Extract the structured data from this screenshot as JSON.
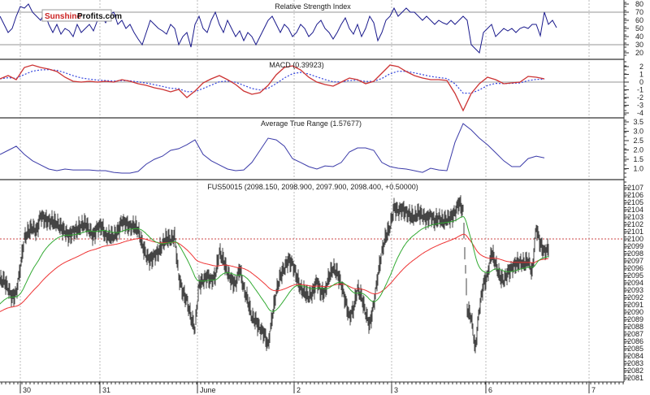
{
  "logo": {
    "part1": "Sunshine",
    "part2": "Profits.com",
    "color1": "#cc2222",
    "color2": "#111111"
  },
  "chart_data": [
    {
      "type": "line",
      "title": "Relative Strength Index",
      "yticks": [
        80,
        70,
        60,
        50,
        40,
        30,
        20
      ],
      "ylim": [
        15,
        85
      ],
      "levels": [
        70,
        30
      ],
      "series": [
        {
          "name": "RSI",
          "color": "#1a1a8c",
          "values": [
            65,
            55,
            45,
            50,
            65,
            77,
            75,
            80,
            70,
            65,
            60,
            70,
            55,
            45,
            55,
            43,
            50,
            47,
            40,
            55,
            45,
            50,
            55,
            47,
            60,
            65,
            57,
            67,
            70,
            55,
            60,
            50,
            55,
            45,
            37,
            30,
            45,
            60,
            55,
            50,
            47,
            43,
            55,
            50,
            30,
            40,
            45,
            27,
            55,
            65,
            50,
            45,
            60,
            70,
            55,
            45,
            60,
            50,
            40,
            47,
            35,
            45,
            40,
            30,
            40,
            50,
            60,
            65,
            55,
            45,
            55,
            50,
            40,
            45,
            55,
            50,
            40,
            45,
            55,
            60,
            50,
            45,
            37,
            45,
            55,
            63,
            50,
            43,
            55,
            40,
            50,
            65,
            57,
            35,
            45,
            60,
            65,
            75,
            65,
            70,
            75,
            70,
            70,
            65,
            60,
            65,
            60,
            55,
            60,
            57,
            55,
            60,
            55,
            60,
            65,
            60,
            30,
            25,
            20,
            45,
            50,
            55,
            40,
            45,
            50,
            47,
            50,
            45,
            50,
            52,
            50,
            55,
            55,
            41,
            70,
            55,
            60,
            51
          ]
        }
      ]
    },
    {
      "type": "line",
      "title": "MACD (0.39923)",
      "yticks": [
        2,
        1,
        0,
        -1,
        -2,
        -3,
        -4
      ],
      "ylim": [
        -4.2,
        2.8
      ],
      "series": [
        {
          "name": "MACD",
          "color": "#cc3333",
          "values": [
            0.42,
            0.84,
            0.32,
            1.89,
            2.21,
            1.89,
            1.68,
            1.37,
            0.63,
            0.11,
            0,
            0.11,
            0,
            0.11,
            0,
            0.32,
            0.11,
            -0.21,
            -0.42,
            -0.74,
            -0.95,
            -1.26,
            -0.95,
            -2.0,
            -1.16,
            -0.11,
            0.42,
            0.84,
            0.32,
            -0.32,
            -1.16,
            -1.58,
            -1.37,
            -0.42,
            0.95,
            1.89,
            2.11,
            1.58,
            0.63,
            0,
            -0.32,
            -0.53,
            0,
            0.53,
            0.32,
            -0.21,
            0.11,
            1.16,
            2.21,
            2.0,
            1.37,
            0.84,
            0.53,
            0.32,
            0.32,
            0.21,
            -1.47,
            -3.68,
            -1.47,
            -0.21,
            0.63,
            0.32,
            -0.21,
            -0.11,
            0,
            0.74,
            0.63,
            0.42
          ]
        },
        {
          "name": "Signal",
          "color": "#3344dd",
          "style": "dotted"
        }
      ]
    },
    {
      "type": "line",
      "title": "Average True Range (1.57677)",
      "yticks": [
        3.5,
        3.0,
        2.5,
        2.0,
        1.5,
        1.0
      ],
      "ylim": [
        0.5,
        3.7
      ],
      "series": [
        {
          "name": "ATR",
          "color": "#3a3aa8",
          "values": [
            1.76,
            1.98,
            2.2,
            1.76,
            1.42,
            1.2,
            0.98,
            0.89,
            0.98,
            0.93,
            0.93,
            0.93,
            0.89,
            0.89,
            0.8,
            0.76,
            0.76,
            0.85,
            1.24,
            1.5,
            1.67,
            1.98,
            2.07,
            2.28,
            2.54,
            1.76,
            1.42,
            1.2,
            0.98,
            0.89,
            0.93,
            1.33,
            1.98,
            2.63,
            2.54,
            2.2,
            1.54,
            1.33,
            1.11,
            0.98,
            1.15,
            1.11,
            1.33,
            1.89,
            2.11,
            2.11,
            1.98,
            1.33,
            1.11,
            1.02,
            0.98,
            0.89,
            0.8,
            1.02,
            0.93,
            0.89,
            2.41,
            3.41,
            3.07,
            2.63,
            2.28,
            1.85,
            1.42,
            1.11,
            1.11,
            1.54,
            1.67,
            1.58
          ]
        }
      ]
    },
    {
      "type": "ohlc",
      "title": "FUS50015 (2098.150, 2098.900, 2097.900, 2098.400, +0.50000)",
      "yticks": [
        2107,
        2106,
        2105,
        2104,
        2103,
        2102,
        2101,
        2100,
        2099,
        2098,
        2097,
        2096,
        2095,
        2094,
        2093,
        2092,
        2091,
        2090,
        2089,
        2088,
        2087,
        2086,
        2085,
        2084,
        2083,
        2082,
        2081
      ],
      "ylim": [
        2079.6,
        2108.4
      ],
      "reference_line": 2100,
      "x_labels": [
        "30",
        "31",
        "June",
        "2",
        "3",
        "6",
        "7"
      ],
      "close": [
        2094.3,
        2094.3,
        2093.2,
        2092,
        2092.6,
        2096,
        2100.1,
        2101,
        2101.6,
        2101,
        2103.2,
        2102.7,
        2102.4,
        2102.4,
        2102.1,
        2101.6,
        2101,
        2100.4,
        2101,
        2101.2,
        2101.8,
        2102.1,
        2101.2,
        2100.4,
        2101.6,
        2101.8,
        2100.4,
        2100.4,
        2100.4,
        2101,
        2102.4,
        2102.1,
        2101.6,
        2101.8,
        2101.2,
        2099.3,
        2097.7,
        2097.1,
        2097.7,
        2098.2,
        2099.3,
        2100.1,
        2099.9,
        2100.4,
        2094.9,
        2092.7,
        2091.6,
        2089.3,
        2087.7,
        2093.8,
        2094.3,
        2094.9,
        2094.3,
        2094.9,
        2098.2,
        2097.1,
        2095.4,
        2094.3,
        2093.8,
        2096,
        2093.2,
        2091.6,
        2089.3,
        2088.8,
        2087.7,
        2087.1,
        2085.4,
        2089.3,
        2092.7,
        2094.9,
        2096,
        2097.1,
        2096.6,
        2094.9,
        2093.2,
        2092.7,
        2092.1,
        2092.7,
        2094.3,
        2092.7,
        2092.7,
        2094.9,
        2096,
        2095.4,
        2093.8,
        2091.6,
        2089.3,
        2090.4,
        2093.2,
        2092.1,
        2089.9,
        2088.2,
        2091,
        2094.9,
        2098.2,
        2100.4,
        2101.6,
        2104.3,
        2103.8,
        2104.1,
        2103.6,
        2103.2,
        2102.9,
        2103.6,
        2103.2,
        2102.7,
        2103.2,
        2102.4,
        2102.9,
        2102.4,
        2102.7,
        2102.9,
        2103.6,
        2105,
        2103.8,
        2090.4,
        2089.3,
        2084.9,
        2090.4,
        2093.8,
        2094.9,
        2098.2,
        2096.6,
        2094.9,
        2094.3,
        2095.4,
        2096,
        2096.6,
        2096.8,
        2096.6,
        2097.1,
        2095.4,
        2101.6,
        2099.3,
        2098.2,
        2098.7
      ],
      "ma_fast_color": "#33aa33",
      "ma_slow_color": "#ee3333"
    }
  ]
}
